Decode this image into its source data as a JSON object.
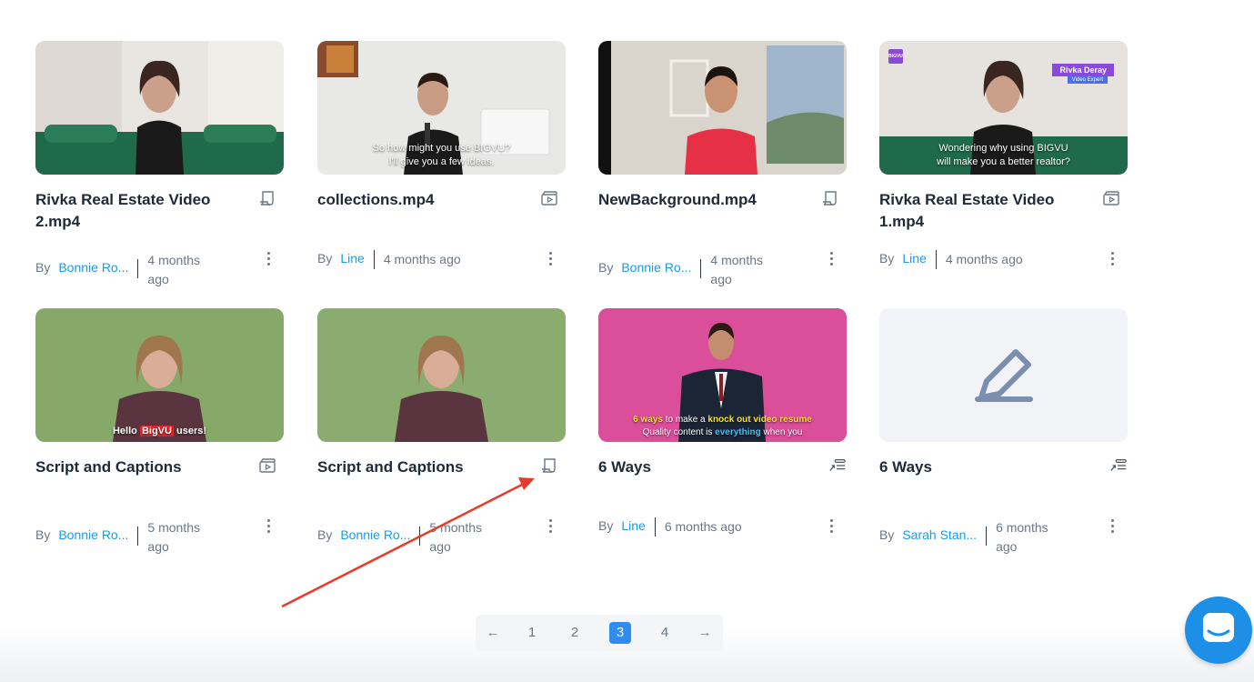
{
  "cards": [
    {
      "title": "Rivka Real Estate Video 2.mp4",
      "author": "Bonnie Ro...",
      "date": "4 months ago",
      "type": "script-icon",
      "by": "By"
    },
    {
      "title": "collections.mp4",
      "author": "Line",
      "date": "4 months ago",
      "type": "video-icon",
      "by": "By",
      "caption_line1": "So how might you use BIGVU?",
      "caption_line2": "I'll give you a few ideas."
    },
    {
      "title": "NewBackground.mp4",
      "author": "Bonnie Ro...",
      "date": "4 months ago",
      "type": "script-icon",
      "by": "By"
    },
    {
      "title": "Rivka Real Estate Video 1.mp4",
      "author": "Line",
      "date": "4 months ago",
      "type": "video-icon",
      "by": "By",
      "logo": "BIGVU",
      "name_tag": "Rivka Deray",
      "role_tag": "Video Expert",
      "caption_line1": "Wondering why using BIGVU",
      "caption_line2": "will make you a better realtor?"
    },
    {
      "title": "Script and Captions",
      "author": "Bonnie Ro...",
      "date": "5 months ago",
      "type": "video-icon",
      "by": "By",
      "caption_pre": "Hello ",
      "caption_hl": "BigVU",
      "caption_post": " users!"
    },
    {
      "title": "Script and Captions",
      "author": "Bonnie Ro...",
      "date": "5 months ago",
      "type": "script-icon",
      "by": "By"
    },
    {
      "title": "6 Ways",
      "author": "Line",
      "date": "6 months ago",
      "type": "teleprompter-icon",
      "by": "By",
      "c1a": "6 ways",
      "c1b": " to make a ",
      "c1c": "knock out video resume",
      "c2a": "Quality content is ",
      "c2b": "everything",
      "c2c": " when you"
    },
    {
      "title": "6 Ways",
      "author": "Sarah Stan...",
      "date": "6 months ago",
      "type": "teleprompter-icon",
      "by": "By"
    }
  ],
  "pagination": {
    "prev": "←",
    "pages": [
      "1",
      "2",
      "3",
      "4"
    ],
    "active": "3",
    "next": "→"
  },
  "colors": {
    "accent": "#2f8cf0",
    "link": "#1b9be6",
    "annotation": "#e83a2a"
  }
}
